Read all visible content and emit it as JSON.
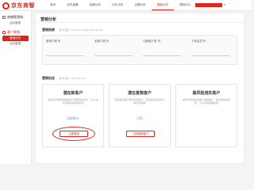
{
  "brand": {
    "logo_text": "京东商智"
  },
  "nav": {
    "items": [
      {
        "label": "首页"
      },
      {
        "label": "实时直播"
      },
      {
        "label": "经营分析"
      },
      {
        "label": "行业分析"
      },
      {
        "label": "主题分析"
      },
      {
        "label": "营销分析"
      },
      {
        "label": "规则中心"
      }
    ],
    "active_index": 5
  },
  "sidebar": {
    "groups": [
      {
        "label": "商铺策营销",
        "items": [
          {
            "label": "活动管理"
          }
        ]
      },
      {
        "label": "客户营销",
        "items": [
          {
            "label": "营销分析"
          },
          {
            "label": "活动管理"
          }
        ]
      }
    ]
  },
  "main": {
    "page_title": "营销分析",
    "overview": {
      "title": "营销效果",
      "date_range": "统计日期：2017-02-20 至 2017-02-26",
      "stats": [
        {
          "label": "新客户数"
        },
        {
          "label": "老客户数"
        },
        {
          "label": "沉睡客户数"
        },
        {
          "label": "下单会员"
        }
      ]
    },
    "opportunity": {
      "title": "营销机会",
      "date_range": "统计日期：2017-02-26",
      "cards": [
        {
          "title": "潜在新客户",
          "desc": "最近有浏览或加购但未下单的潜在客户，可以通过营销手段促成转化",
          "count": "10000+",
          "button": "立即营销"
        },
        {
          "title": "潜在复购客户",
          "desc": "曾经在店铺下单过的老客户，通过营销活动可以提高复购率",
          "count": "145",
          "button": "立即营销客户"
        },
        {
          "title": "高风险流失客户",
          "desc": "较长时间未在店铺下单的客户，存在流失的风险，可以定向营销召回",
          "count": "",
          "button": ""
        }
      ]
    }
  },
  "colors": {
    "brand_red": "#e1251b",
    "count_blue": "#5b8fd8",
    "annotation_ring": "#d9302f"
  }
}
